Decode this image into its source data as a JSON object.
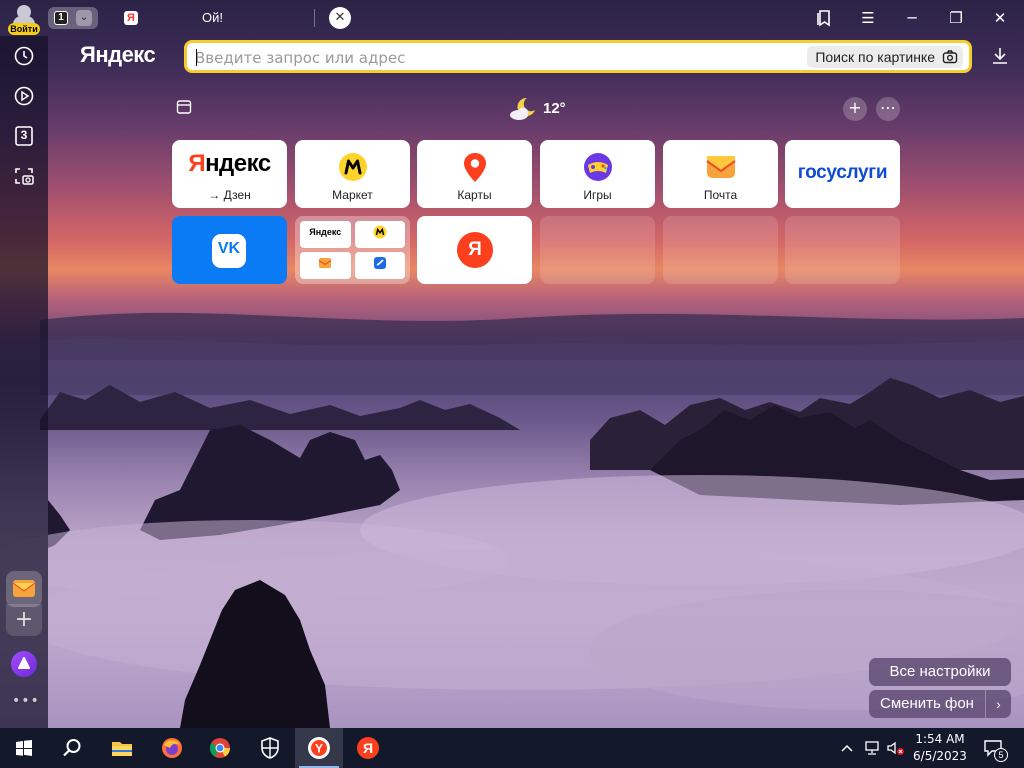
{
  "titlebar": {
    "login_label": "Войти",
    "tab_count": "1",
    "tab_title": "Ой!",
    "tab_favicon": "Я"
  },
  "sidebar": {
    "items": [
      {
        "icon": "history-icon"
      },
      {
        "icon": "play-icon"
      },
      {
        "icon": "tab-count-icon",
        "label": "3"
      },
      {
        "icon": "screenshot-icon"
      }
    ]
  },
  "addressbar": {
    "logo": "Яндекс",
    "placeholder": "Введите запрос или адрес",
    "image_search_label": "Поиск по картинке"
  },
  "weather": {
    "temperature": "12°",
    "icon": "moon-cloud-icon"
  },
  "tiles": [
    {
      "name": "yandex-dzen",
      "line1": "Яндекс",
      "line2": "→ Дзен"
    },
    {
      "name": "market",
      "label": "Маркет"
    },
    {
      "name": "maps",
      "label": "Карты"
    },
    {
      "name": "games",
      "label": "Игры"
    },
    {
      "name": "mail",
      "label": "Почта"
    },
    {
      "name": "gosuslugi",
      "label": "госуслуги"
    },
    {
      "name": "vk",
      "label": "VK"
    },
    {
      "name": "folder",
      "mini_label": "Яндекс"
    },
    {
      "name": "yandex",
      "label": "Я"
    }
  ],
  "settings": {
    "all_settings_label": "Все настройки",
    "change_bg_label": "Сменить фон"
  },
  "taskbar": {
    "time": "1:54 AM",
    "date": "6/5/2023",
    "notification_count": "5"
  },
  "colors": {
    "accent_yellow": "#f6cd2e",
    "vk_blue": "#0a7af5",
    "yandex_red": "#fc3f1d",
    "gosuslugi_blue": "#0d4cd3",
    "gosuslugi_red": "#ee3f58"
  }
}
